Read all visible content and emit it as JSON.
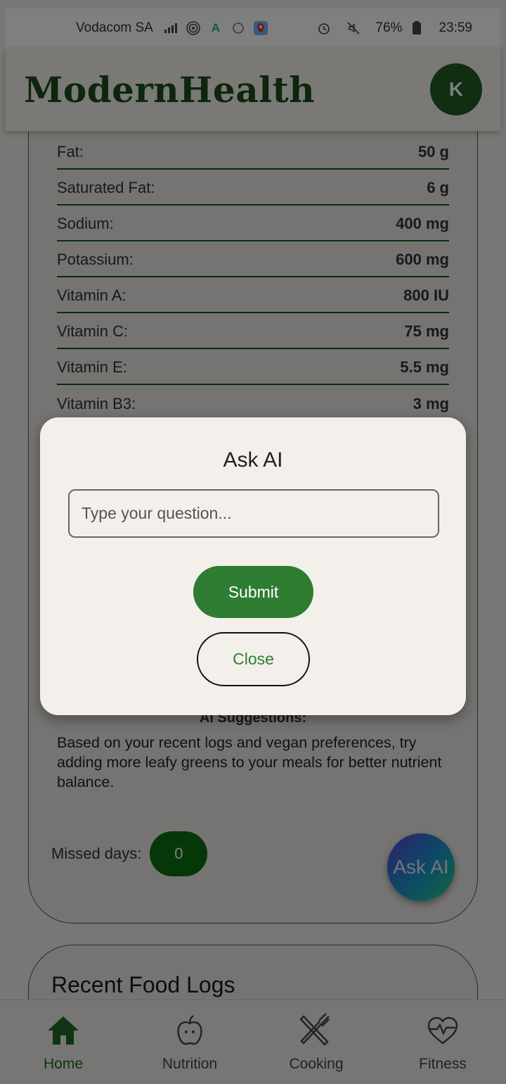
{
  "status_bar": {
    "carrier": "Vodacom SA",
    "battery": "76%",
    "time": "23:59"
  },
  "header": {
    "title": "ModernHealth",
    "avatar_initial": "K"
  },
  "nutrition": {
    "rows": [
      {
        "label": "Fat:",
        "value": "50 g"
      },
      {
        "label": "Saturated Fat:",
        "value": "6 g"
      },
      {
        "label": "Sodium:",
        "value": "400 mg"
      },
      {
        "label": "Potassium:",
        "value": "600 mg"
      },
      {
        "label": "Vitamin A:",
        "value": "800 IU"
      },
      {
        "label": "Vitamin C:",
        "value": "75 mg"
      },
      {
        "label": "Vitamin E:",
        "value": "5.5 mg"
      },
      {
        "label": "Vitamin B3:",
        "value": "3 mg"
      }
    ]
  },
  "ai_suggestions": {
    "title": "AI Suggestions:",
    "text": "Based on your recent logs and vegan preferences, try adding more leafy greens to your meals for better nutrient balance."
  },
  "missed_days": {
    "label": "Missed days:",
    "value": "0"
  },
  "fab": {
    "label": "Ask AI"
  },
  "recent_logs": {
    "title": "Recent Food Logs"
  },
  "dialog": {
    "title": "Ask AI",
    "input_placeholder": "Type your question...",
    "input_value": "",
    "submit_label": "Submit",
    "close_label": "Close"
  },
  "bottom_nav": {
    "items": [
      {
        "label": "Home",
        "icon": "home-icon",
        "active": true
      },
      {
        "label": "Nutrition",
        "icon": "apple-icon",
        "active": false
      },
      {
        "label": "Cooking",
        "icon": "fork-knife-icon",
        "active": false
      },
      {
        "label": "Fitness",
        "icon": "heartbeat-icon",
        "active": false
      }
    ]
  },
  "colors": {
    "brand": "#1b4d1b",
    "primary": "#2e7d32",
    "divider": "#0f5a14"
  }
}
